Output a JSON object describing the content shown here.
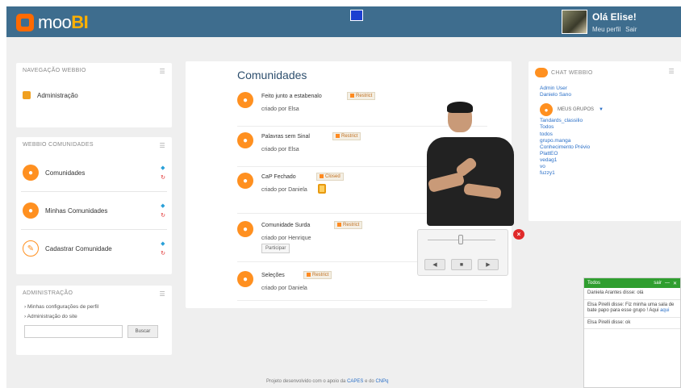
{
  "app": {
    "logo_prefix": "moo",
    "logo_suffix": "BI",
    "user_name": "Olá Elise!",
    "user_links": [
      "Meu perfil",
      "Sair"
    ]
  },
  "nav_panel": {
    "title": "NAVEGAÇÃO WEBBIO",
    "items": [
      {
        "label": "Administração"
      }
    ]
  },
  "communities_panel": {
    "title": "WEBBIO COMUNIDADES",
    "items": [
      {
        "label": "Comunidades"
      },
      {
        "label": "Minhas Comunidades"
      },
      {
        "label": "Cadastrar Comunidade"
      }
    ]
  },
  "admin_panel": {
    "title": "ADMINISTRAÇÃO",
    "links": [
      "Minhas configurações de perfil",
      "Administração do site"
    ],
    "search_value": "",
    "search_button": "Buscar"
  },
  "main": {
    "title": "Comunidades",
    "items": [
      {
        "name": "Feito junto a estabenalo",
        "by": "criado por Elsa",
        "tag": "Restrict"
      },
      {
        "name": "Palavras sem Sinal",
        "by": "criado por Elsa",
        "tag": "Restrict"
      },
      {
        "name": "CaP Fechado",
        "by": "criado por Daniela",
        "tag": "Closed"
      },
      {
        "name": "Comunidade Surda",
        "by": "criado por Henrique",
        "tag": "Restrict",
        "action": "Participar"
      },
      {
        "name": "Seleções",
        "by": "criado por Daniela",
        "tag": "Restrict"
      }
    ]
  },
  "chat_panel": {
    "title": "CHAT WEBBIO",
    "users": [
      "Admin User",
      "Danielo Sano"
    ],
    "groups_title": "MEUS GRUPOS",
    "groups": [
      "Tandards_classilio",
      "Todos",
      "todos",
      "grupo.manga",
      "Conhecimento Prévio",
      "PlattEO",
      "vedag1",
      "vo",
      "fuzzy1"
    ]
  },
  "video": {
    "buttons": [
      "◀",
      "■",
      "▶"
    ],
    "close": "×"
  },
  "chat_window": {
    "title": "Todos",
    "header_right": "sair",
    "messages": [
      {
        "text": "Daniela Arantes disse: olá"
      },
      {
        "text": "Elsa Pirelli disse: Fiz minha uma sala de bate papo para esse grupo ! Aqui "
      },
      {
        "text": "Elsa Pirelli disse: ok"
      }
    ],
    "message_link": "aqui"
  },
  "footer": {
    "text": "Projeto desenvolvido com o apoio da ",
    "link1": "CAPES",
    "mid": " e do ",
    "link2": "CNPq"
  },
  "colors": {
    "topbar": "#3e6d8e",
    "accent": "#ff9020",
    "chat_header": "#2f9e2f"
  }
}
